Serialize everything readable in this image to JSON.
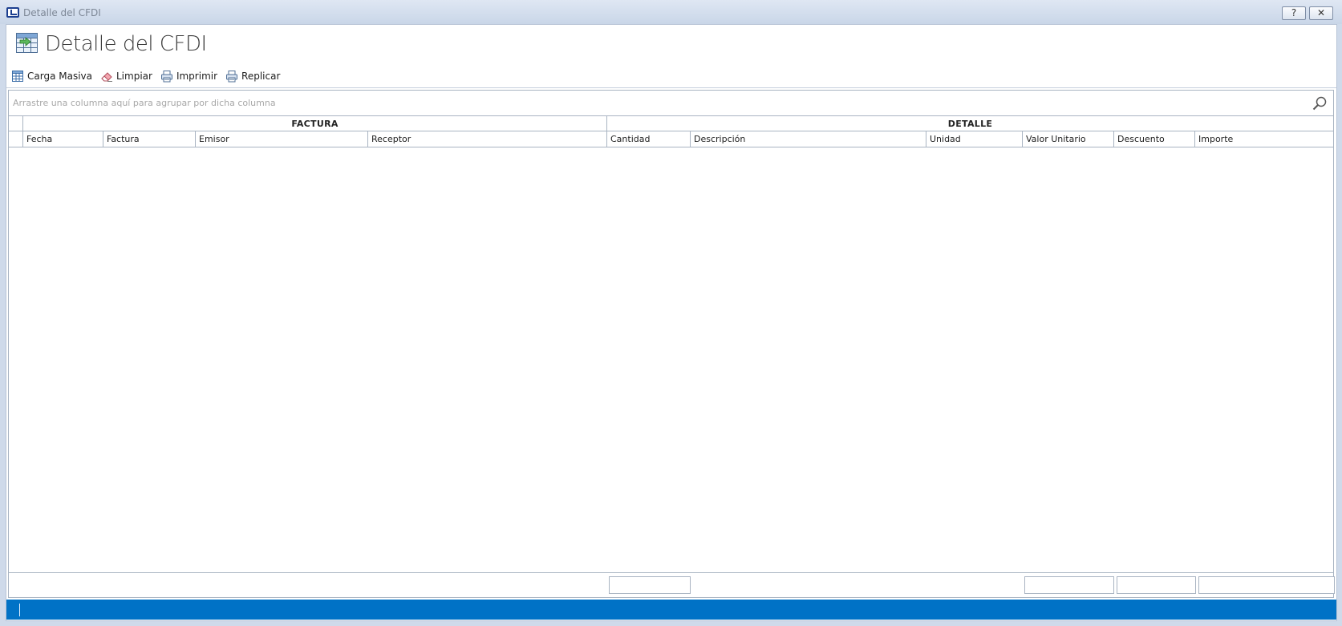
{
  "window": {
    "title": "Detalle del CFDI",
    "help_label": "?",
    "close_label": "✕"
  },
  "page": {
    "title": "Detalle del CFDI"
  },
  "toolbar": {
    "items": [
      {
        "label": "Carga Masiva",
        "icon": "bulk-load-icon"
      },
      {
        "label": "Limpiar",
        "icon": "eraser-icon"
      },
      {
        "label": "Imprimir",
        "icon": "printer-icon"
      },
      {
        "label": "Replicar",
        "icon": "printer-icon"
      }
    ]
  },
  "grid": {
    "group_panel_hint": "Arrastre una columna aquí para agrupar por dicha columna",
    "bands": [
      {
        "label": "FACTURA"
      },
      {
        "label": "DETALLE"
      }
    ],
    "columns": [
      {
        "label": "Fecha"
      },
      {
        "label": "Factura"
      },
      {
        "label": "Emisor"
      },
      {
        "label": "Receptor"
      },
      {
        "label": "Cantidad"
      },
      {
        "label": "Descripción"
      },
      {
        "label": "Unidad"
      },
      {
        "label": "Valor Unitario"
      },
      {
        "label": "Descuento"
      },
      {
        "label": "Importe"
      }
    ],
    "rows": []
  },
  "colors": {
    "statusbar": "#0072c6",
    "grid_border": "#a9b4c2"
  }
}
